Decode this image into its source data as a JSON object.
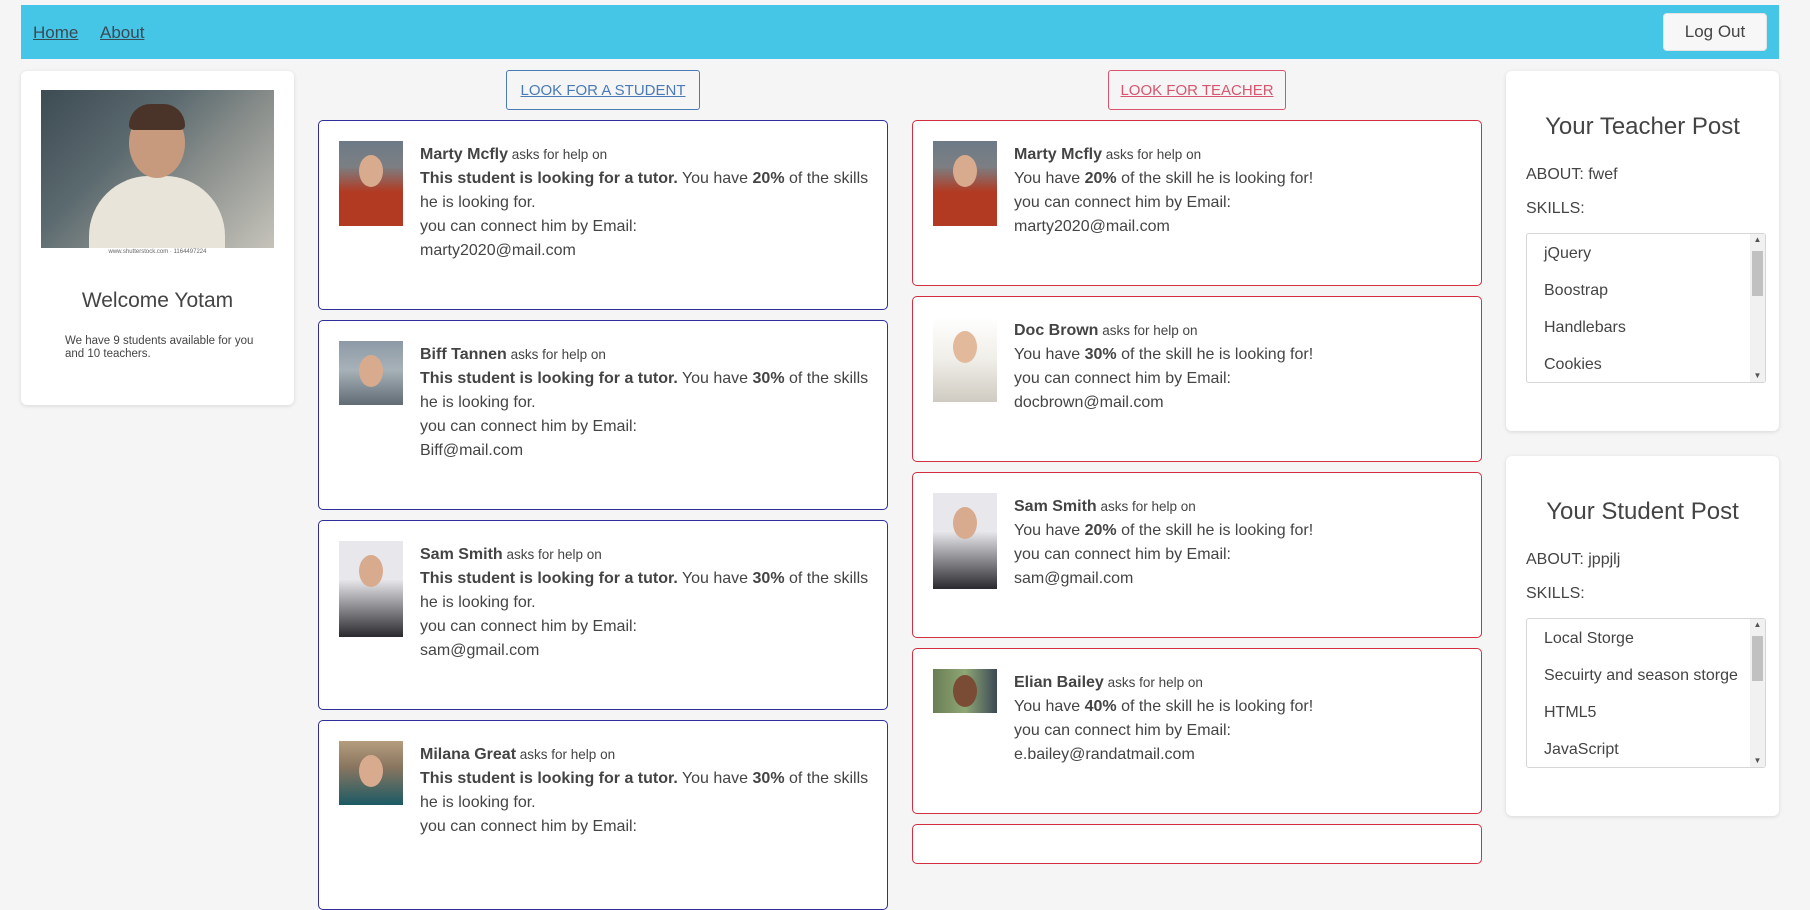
{
  "nav": {
    "home": "Home",
    "about": "About",
    "logout": "Log Out"
  },
  "welcome": {
    "photo_caption": "www.shutterstock.com · 1164497224",
    "title": "Welcome Yotam",
    "text": "We have 9 students available for you and 10 teachers."
  },
  "buttons": {
    "look_student": "LOOK FOR A STUDENT",
    "look_teacher": "LOOK FOR TEACHER"
  },
  "common": {
    "asks": " asks for help on",
    "student_line1_bold": "This student is looking for a tutor.",
    "you_have": " You have ",
    "of_skills_student": " of the skills he is looking for.",
    "teacher_you_have": "You have ",
    "of_skill_teacher": " of the skill he is looking for!",
    "connect": "you can connect him by Email:"
  },
  "students": [
    {
      "name": "Marty Mcfly",
      "percent": "20%",
      "email": "marty2020@mail.com",
      "avatar": "marty-photo"
    },
    {
      "name": "Biff Tannen",
      "percent": "30%",
      "email": "Biff@mail.com",
      "avatar": "biff-photo"
    },
    {
      "name": "Sam Smith",
      "percent": "30%",
      "email": "sam@gmail.com",
      "avatar": "sam-photo"
    },
    {
      "name": "Milana Great",
      "percent": "30%",
      "email": "",
      "avatar": "milana-photo"
    }
  ],
  "teachers": [
    {
      "name": "Marty Mcfly",
      "percent": "20%",
      "email": "marty2020@mail.com",
      "avatar": "marty-photo"
    },
    {
      "name": "Doc Brown",
      "percent": "30%",
      "email": "docbrown@mail.com",
      "avatar": "doc-photo"
    },
    {
      "name": "Sam Smith",
      "percent": "20%",
      "email": "sam@gmail.com",
      "avatar": "sam-photo"
    },
    {
      "name": "Elian Bailey",
      "percent": "40%",
      "email": "e.bailey@randatmail.com",
      "avatar": "elian-photo"
    }
  ],
  "teacher_post": {
    "title": "Your Teacher Post",
    "about": "ABOUT: fwef",
    "skills_label": "SKILLS:",
    "skills": [
      "jQuery",
      "Boostrap",
      "Handlebars",
      "Cookies"
    ]
  },
  "student_post": {
    "title": "Your Student Post",
    "about": "ABOUT: jppjlj",
    "skills_label": "SKILLS:",
    "skills": [
      "Local Storge",
      "Secuirty and season storge",
      "HTML5",
      "JavaScript"
    ]
  }
}
